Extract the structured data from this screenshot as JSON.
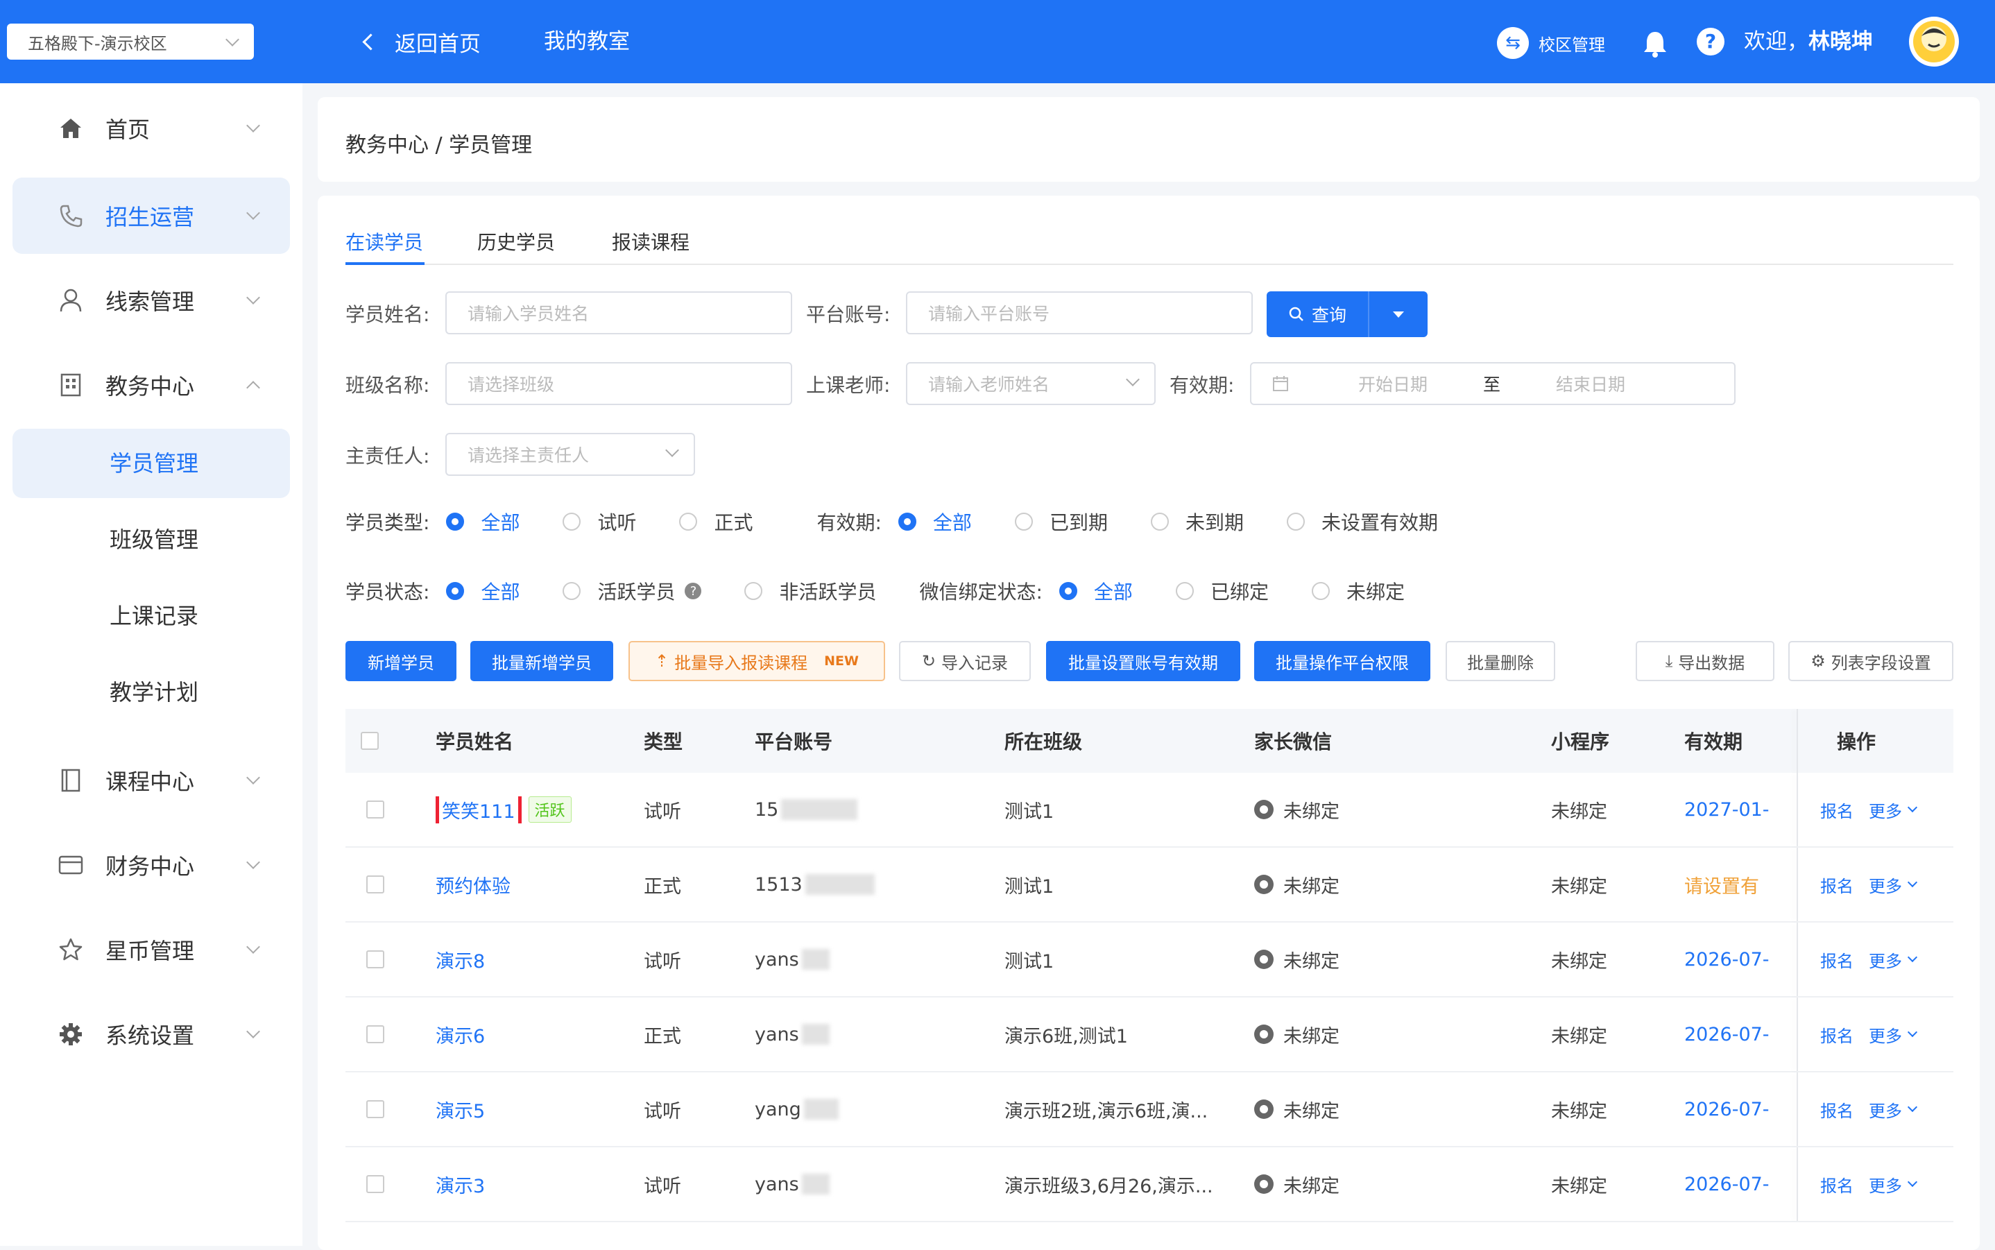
{
  "header": {
    "campus_select": "五格殿下-演示校区",
    "back_home": "返回首页",
    "my_classroom": "我的教室",
    "campus_mgmt": "校区管理",
    "welcome": "欢迎，",
    "user_name": "林晓坤",
    "brand_color": "#1f73f5"
  },
  "sidebar": {
    "items": [
      {
        "label": "首页",
        "icon": "home-icon"
      },
      {
        "label": "招生运营",
        "icon": "phone-icon",
        "active": true
      },
      {
        "label": "线索管理",
        "icon": "user-icon"
      },
      {
        "label": "教务中心",
        "icon": "building-icon",
        "expanded": true
      },
      {
        "label": "课程中心",
        "icon": "book-icon"
      },
      {
        "label": "财务中心",
        "icon": "card-icon"
      },
      {
        "label": "星币管理",
        "icon": "star-icon"
      },
      {
        "label": "系统设置",
        "icon": "gear-icon"
      }
    ],
    "sub_items": [
      {
        "label": "学员管理",
        "active": true
      },
      {
        "label": "班级管理"
      },
      {
        "label": "上课记录"
      },
      {
        "label": "教学计划"
      }
    ]
  },
  "breadcrumb": "教务中心 / 学员管理",
  "tabs": [
    "在读学员",
    "历史学员",
    "报读课程"
  ],
  "filters": {
    "student_name_label": "学员姓名:",
    "student_name_placeholder": "请输入学员姓名",
    "platform_account_label": "平台账号:",
    "platform_account_placeholder": "请输入平台账号",
    "query_button": "查询",
    "class_name_label": "班级名称:",
    "class_name_placeholder": "请选择班级",
    "teacher_label": "上课老师:",
    "teacher_placeholder": "请输入老师姓名",
    "validity_label": "有效期:",
    "start_date_placeholder": "开始日期",
    "date_sep": "至",
    "end_date_placeholder": "结束日期",
    "owner_label": "主责任人:",
    "owner_placeholder": "请选择主责任人",
    "student_type_label": "学员类型:",
    "student_type_options": [
      "全部",
      "试听",
      "正式"
    ],
    "validity_radio_label": "有效期:",
    "validity_options": [
      "全部",
      "已到期",
      "未到期",
      "未设置有效期"
    ],
    "student_status_label": "学员状态:",
    "student_status_options": [
      "全部",
      "活跃学员",
      "非活跃学员"
    ],
    "wechat_label": "微信绑定状态:",
    "wechat_options": [
      "全部",
      "已绑定",
      "未绑定"
    ]
  },
  "actions": {
    "add_student": "新增学员",
    "batch_add": "批量新增学员",
    "batch_import": "批量导入报读课程",
    "new_tag": "NEW",
    "import_records": "导入记录",
    "batch_validity": "批量设置账号有效期",
    "batch_permission": "批量操作平台权限",
    "batch_delete": "批量删除",
    "export": "导出数据",
    "column_settings": "列表字段设置"
  },
  "table": {
    "columns": [
      "学员姓名",
      "类型",
      "平台账号",
      "所在班级",
      "家长微信",
      "小程序",
      "有效期",
      "操作"
    ],
    "rows": [
      {
        "name": "笑笑111",
        "tag": "活跃",
        "type": "试听",
        "account": "15",
        "class": "测试1",
        "wechat": "未绑定",
        "mini": "未绑定",
        "expire": "2027-01-",
        "expire_style": "blue",
        "op1": "报名",
        "op2": "更多"
      },
      {
        "name": "预约体验",
        "tag": "",
        "type": "正式",
        "account": "1513",
        "class": "测试1",
        "wechat": "未绑定",
        "mini": "未绑定",
        "expire": "请设置有",
        "expire_style": "orange",
        "op1": "报名",
        "op2": "更多"
      },
      {
        "name": "演示8",
        "tag": "",
        "type": "试听",
        "account": "yans",
        "class": "测试1",
        "wechat": "未绑定",
        "mini": "未绑定",
        "expire": "2026-07-",
        "expire_style": "blue",
        "op1": "报名",
        "op2": "更多"
      },
      {
        "name": "演示6",
        "tag": "",
        "type": "正式",
        "account": "yans",
        "class": "演示6班,测试1",
        "wechat": "未绑定",
        "mini": "未绑定",
        "expire": "2026-07-",
        "expire_style": "blue",
        "op1": "报名",
        "op2": "更多"
      },
      {
        "name": "演示5",
        "tag": "",
        "type": "试听",
        "account": "yang",
        "class": "演示班2班,演示6班,演...",
        "wechat": "未绑定",
        "mini": "未绑定",
        "expire": "2026-07-",
        "expire_style": "blue",
        "op1": "报名",
        "op2": "更多"
      },
      {
        "name": "演示3",
        "tag": "",
        "type": "试听",
        "account": "yans",
        "class": "演示班级3,6月26,演示...",
        "wechat": "未绑定",
        "mini": "未绑定",
        "expire": "2026-07-",
        "expire_style": "blue",
        "op1": "报名",
        "op2": "更多"
      }
    ]
  }
}
